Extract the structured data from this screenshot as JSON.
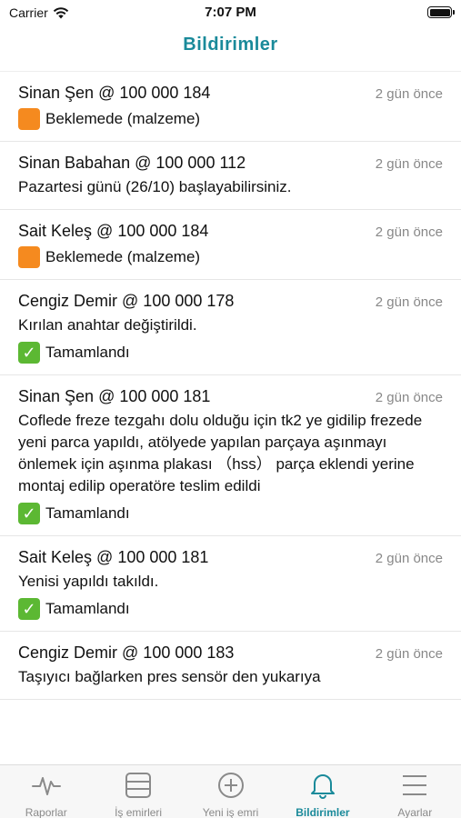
{
  "status_bar": {
    "carrier": "Carrier",
    "time": "7:07 PM"
  },
  "nav": {
    "title": "Bildirimler"
  },
  "notifications": [
    {
      "sender": "Sinan Şen @ 100 000 184",
      "time": "2 gün önce",
      "message": "",
      "status": "Beklemede (malzeme)",
      "status_type": "pending"
    },
    {
      "sender": "Sinan Babahan @ 100 000 112",
      "time": "2 gün önce",
      "message": "Pazartesi günü (26/10) başlayabilirsiniz.",
      "status": "",
      "status_type": ""
    },
    {
      "sender": "Sait Keleş @ 100 000 184",
      "time": "2 gün önce",
      "message": "",
      "status": "Beklemede (malzeme)",
      "status_type": "pending"
    },
    {
      "sender": "Cengiz Demir @ 100 000 178",
      "time": "2 gün önce",
      "message": "Kırılan anahtar değiştirildi.",
      "status": "Tamamlandı",
      "status_type": "done"
    },
    {
      "sender": "Sinan Şen @ 100 000 181",
      "time": "2 gün önce",
      "message": "Coflede freze tezgahı dolu olduğu için tk2 ye gidilip frezede yeni parca yapıldı, atölyede yapılan parçaya aşınmayı önlemek için aşınma plakası （hss） parça eklendi yerine montaj edilip operatöre teslim edildi",
      "status": "Tamamlandı",
      "status_type": "done"
    },
    {
      "sender": "Sait Keleş @ 100 000 181",
      "time": "2 gün önce",
      "message": "Yenisi yapıldı takıldı.",
      "status": "Tamamlandı",
      "status_type": "done"
    },
    {
      "sender": "Cengiz Demir @ 100 000 183",
      "time": "2 gün önce",
      "message": "Taşıyıcı bağlarken pres sensör den yukarıya",
      "status": "",
      "status_type": ""
    }
  ],
  "tabbar": {
    "tabs": [
      {
        "label": "Raporlar",
        "icon": "pulse-icon",
        "active": false
      },
      {
        "label": "İş emirleri",
        "icon": "list-icon",
        "active": false
      },
      {
        "label": "Yeni iş emri",
        "icon": "add-circle-icon",
        "active": false
      },
      {
        "label": "Bildirimler",
        "icon": "bell-icon",
        "active": true
      },
      {
        "label": "Ayarlar",
        "icon": "menu-icon",
        "active": false
      }
    ]
  },
  "colors": {
    "accent": "#1a8a9a",
    "inactive": "#8a8a8a",
    "pending": "#f58a1f",
    "done": "#5cb833"
  }
}
